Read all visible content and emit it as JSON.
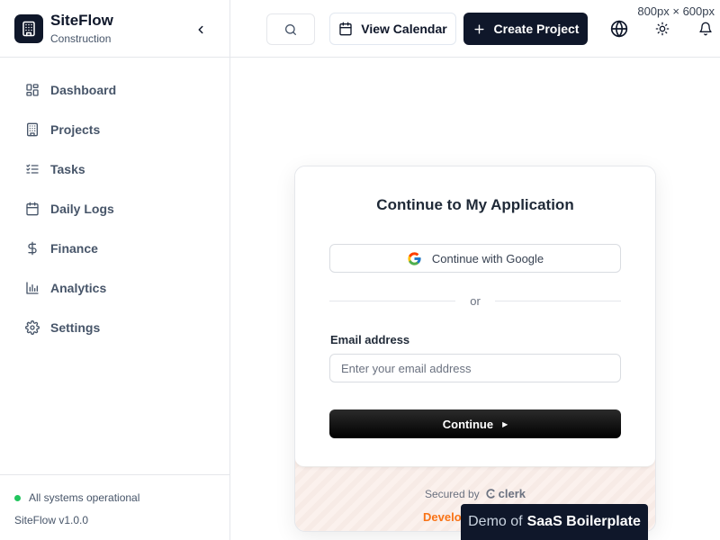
{
  "brand": {
    "name": "SiteFlow",
    "subtitle": "Construction"
  },
  "nav": [
    {
      "label": "Dashboard",
      "icon": "dashboard-icon"
    },
    {
      "label": "Projects",
      "icon": "building-icon"
    },
    {
      "label": "Tasks",
      "icon": "checklist-icon"
    },
    {
      "label": "Daily Logs",
      "icon": "calendar-icon"
    },
    {
      "label": "Finance",
      "icon": "dollar-icon"
    },
    {
      "label": "Analytics",
      "icon": "bar-chart-icon"
    },
    {
      "label": "Settings",
      "icon": "gear-icon"
    }
  ],
  "footer": {
    "status": "All systems operational",
    "status_color": "#22c55e",
    "version": "SiteFlow v1.0.0"
  },
  "header": {
    "view_calendar": "View Calendar",
    "create_project": "Create Project",
    "dims": "800px × 600px"
  },
  "auth": {
    "title": "Continue to My Application",
    "google": "Continue with Google",
    "or": "or",
    "email_label": "Email address",
    "email_placeholder": "Enter your email address",
    "continue": "Continue",
    "secured_by": "Secured by",
    "clerk": "clerk",
    "dev_mode": "Development mode"
  },
  "demo": {
    "prefix": "Demo of",
    "name": "SaaS Boilerplate"
  },
  "colors": {
    "primary": "#0f172a",
    "accent": "#f97316"
  }
}
